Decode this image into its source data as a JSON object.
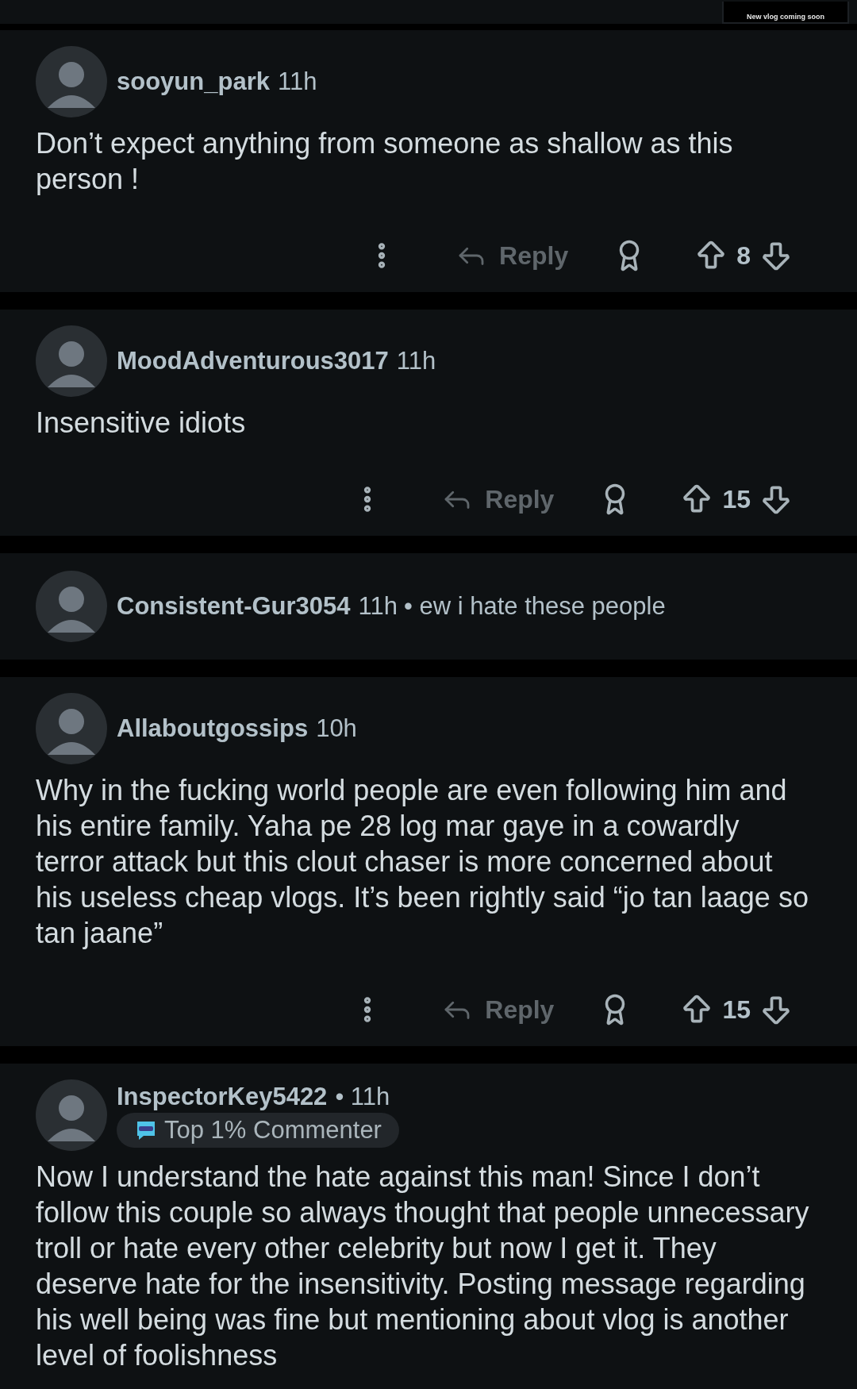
{
  "top_strip": {
    "thumbnail_caption": "New vlog coming soon"
  },
  "comments": [
    {
      "kind": "full",
      "username": "sooyun_park",
      "time": "11h",
      "body": "Don’t expect anything from someone as shallow as this person !",
      "reply_label": "Reply",
      "votes": "8"
    },
    {
      "kind": "full",
      "username": "MoodAdventurous3017",
      "time": "11h",
      "body": "Insensitive idiots",
      "reply_label": "Reply",
      "votes": "15"
    },
    {
      "kind": "collapsed",
      "username": "Consistent-Gur3054",
      "time": "11h",
      "preview": "• ew i hate these people"
    },
    {
      "kind": "full",
      "username": "Allaboutgossips",
      "time": "10h",
      "body": "Why in the fucking world people are even following him and his entire family. Yaha pe 28 log mar gaye in a cowardly terror attack but this clout chaser is more concerned about his useless cheap vlogs. It’s been rightly said “jo tan laage so tan jaane”",
      "reply_label": "Reply",
      "votes": "15"
    },
    {
      "kind": "full",
      "username": "InspectorKey5422",
      "time": "• 11h",
      "badge": "Top 1% Commenter",
      "body": "Now I understand the hate against this man! Since I don’t follow this couple so always thought that people unnecessary troll or hate every other celebrity but now I get it. They deserve hate for the insensitivity. Posting message regarding his well being was fine but mentioning about vlog is another level of foolishness"
    }
  ]
}
